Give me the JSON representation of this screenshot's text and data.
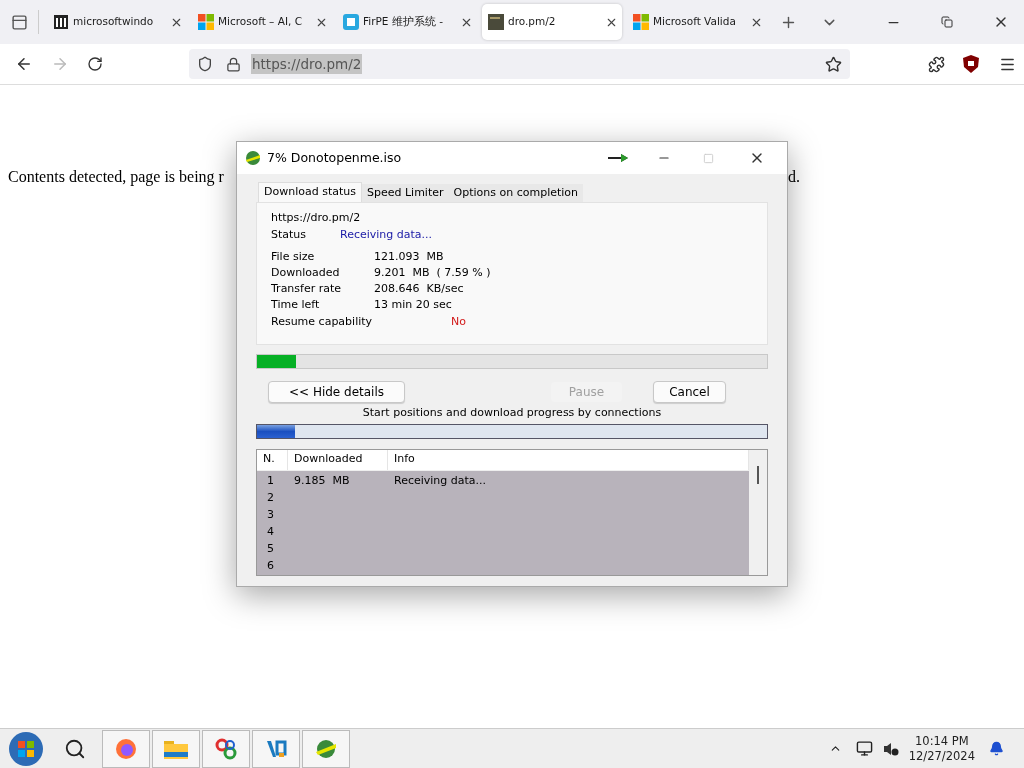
{
  "browser": {
    "tabs": [
      {
        "title": "microsoftwindo",
        "kind": "archive",
        "selected": false
      },
      {
        "title": "Microsoft – AI, C",
        "kind": "windows",
        "selected": false
      },
      {
        "title": "FirPE 维护系统 -",
        "kind": "tile",
        "selected": false
      },
      {
        "title": "dro.pm/2",
        "kind": "thumb",
        "selected": true
      },
      {
        "title": "Microsoft Valida",
        "kind": "windows",
        "selected": false
      }
    ],
    "address": "https://dro.pm/2"
  },
  "page": {
    "text_left": "Contents detected, page is being r",
    "text_right": "d."
  },
  "dialog": {
    "title": "7% Donotopenme.iso",
    "tabs": [
      {
        "label": "Download status",
        "selected": true
      },
      {
        "label": "Speed Limiter",
        "selected": false
      },
      {
        "label": "Options on completion",
        "selected": false
      }
    ],
    "url": "https://dro.pm/2",
    "status": {
      "label": "Status",
      "value": "Receiving data..."
    },
    "fields": [
      {
        "label": "File size",
        "value": "121.093  MB"
      },
      {
        "label": "Downloaded",
        "value": "9.201  MB  ( 7.59 % )"
      },
      {
        "label": "Transfer rate",
        "value": "208.646  KB/sec"
      },
      {
        "label": "Time left",
        "value": "13 min 20 sec"
      }
    ],
    "resume": {
      "label": "Resume capability",
      "value": "No"
    },
    "progress": {
      "level": 0.0759
    },
    "buttons": [
      {
        "label": "<< Hide details",
        "disabled": false
      },
      {
        "label": "Pause",
        "disabled": true
      },
      {
        "label": "Cancel",
        "disabled": false
      }
    ],
    "connections_caption": "Start positions and download progress by connections",
    "connections": {
      "level": 0.075
    },
    "table": {
      "columns": [
        "N.",
        "Downloaded",
        "Info"
      ],
      "rows": [
        [
          "1",
          "9.185  MB",
          "Receiving data..."
        ],
        [
          "2"
        ],
        [
          "3"
        ],
        [
          "4"
        ],
        [
          "5"
        ],
        [
          "6"
        ]
      ]
    }
  },
  "taskbar": {
    "time": "10:14 PM",
    "date": "12/27/2024"
  }
}
